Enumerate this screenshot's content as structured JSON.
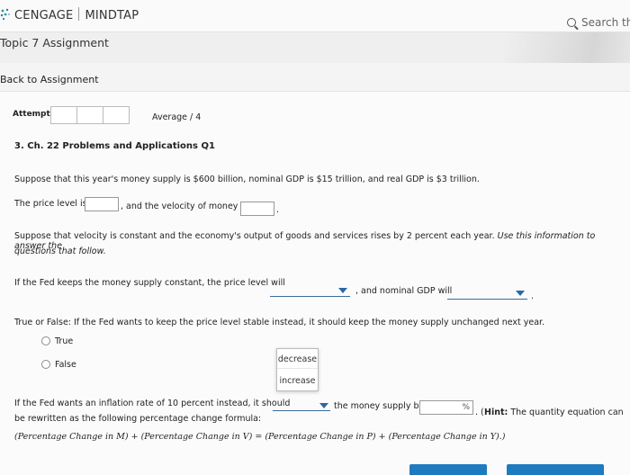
{
  "header": {
    "brand_left": "CENGAGE",
    "brand_right": "MINDTAP",
    "search_label": "Search thi"
  },
  "subbar": {
    "title": "Topic 7 Assignment"
  },
  "back_link": "Back to Assignment",
  "attempts": {
    "label": "Attempts",
    "average": "Average / 4"
  },
  "question": {
    "title": "3. Ch. 22 Problems and Applications Q1",
    "intro": "Suppose that this year's money supply is $600 billion, nominal GDP is $15 trillion, and real GDP is $3 trillion.",
    "price_level_prefix": "The price level is",
    "velocity_prefix": ", and the velocity of money is",
    "velocity_suffix": ".",
    "assumption_line1": "Suppose that velocity is constant and the economy's output of goods and services rises by 2 percent each year.",
    "assumption_italic1": "Use this information to answer the",
    "assumption_italic2": "questions that follow.",
    "fed_constant_prefix": "If the Fed keeps the money supply constant, the price level will",
    "fed_constant_mid": ", and nominal GDP will",
    "fed_constant_suffix": ".",
    "tf_prompt": "True or False: If the Fed wants to keep the price level stable instead, it should keep the money supply unchanged next year.",
    "tf_options": [
      "True",
      "False"
    ],
    "dropdown_options": [
      "decrease",
      "increase"
    ],
    "inflation_prefix": "If the Fed wants an inflation rate of 10 percent instead, it should",
    "inflation_mid": "the money supply by",
    "percent_sign": "%",
    "hint_end": ". (",
    "hint_label": "Hint:",
    "hint_text": "The quantity equation can",
    "hint_line2": "be rewritten as the following percentage change formula:",
    "formula": "(Percentage Change in M) + (Percentage Change in V) = (Percentage Change in P) + (Percentage Change in Y).)"
  }
}
